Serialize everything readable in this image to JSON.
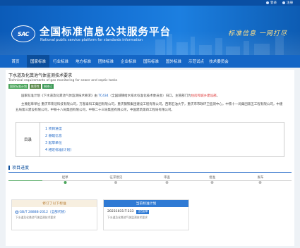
{
  "topbar": {
    "login": "登录",
    "register": "注册"
  },
  "header": {
    "logo_text": "SAC",
    "title": "全国标准信息公共服务平台",
    "subtitle": "National public service platform  for standards information",
    "slogan": "标准信息 一网打尽"
  },
  "nav": {
    "items": [
      {
        "label": "首页"
      },
      {
        "label": "国家标准",
        "active": true
      },
      {
        "label": "行业标准"
      },
      {
        "label": "地方标准"
      },
      {
        "label": "团体标准"
      },
      {
        "label": "企业标准"
      },
      {
        "label": "国际标准"
      },
      {
        "label": "国外标准"
      },
      {
        "label": "示范试点"
      },
      {
        "label": "技术委员会"
      }
    ]
  },
  "standard": {
    "title": "下水道及化粪池气体监测技术要求",
    "title_en": "Technical requirements of gas monitoring for sewer and septic tanks",
    "badges": [
      "国家标准计划",
      "推荐性",
      "制修订"
    ],
    "desc_intro": "国家标准计划《下水道及化粪池气体监测技术要求》由 ",
    "desc_tc": "TC434",
    "desc_mid": "（全国城镇给水排水标准化技术委员会）归口，主管部门为",
    "desc_dept": "住房和城乡建设部",
    "desc_end": "。",
    "drafters": "主要起草单位 重庆市荣冠科技有限公司，万基泰科工集团有限公司，重庆钢铁集团建设工程有限公司，西南石油大学，重庆市市政环卫监测中心，中铁十一局集团第五工程有限公司，中建五局第三建设有限公司，中铁十八局集团有限公司，中铁二十三局集团有限公司，中国建筑第四工程局有限公司。"
  },
  "toc": {
    "label": "目录",
    "items": [
      "1  项目进度",
      "2  基础信息",
      "3  起草单位",
      "4  相近标准(计划)"
    ]
  },
  "progress": {
    "section_title": "项目进度",
    "steps": [
      "起草",
      "征求意见",
      "审查",
      "批准",
      "发布"
    ],
    "completed_fraction": 0.12
  },
  "boxes": {
    "prev_head": "修订了以下标准",
    "prev_code": "GB/T 28888-2012（全部代替）",
    "prev_cap": "下水道及化粪池气体监测技术要求",
    "cur_head": "当前标准计划",
    "cur_code": "20231031-T-333",
    "cur_pill": "正在起草",
    "cur_cap": "下水道及化粪池气体监测技术要求"
  }
}
